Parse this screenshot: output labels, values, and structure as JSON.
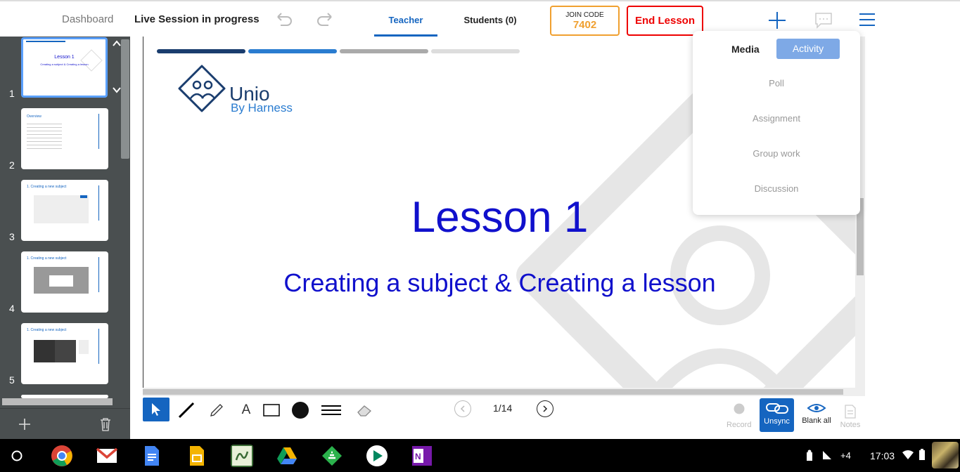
{
  "header": {
    "dashboard_label": "Dashboard",
    "session_label": "Live Session in progress",
    "tabs": [
      {
        "label": "Teacher",
        "active": true
      },
      {
        "label": "Students (0)",
        "active": false
      }
    ],
    "join_code": {
      "label": "JOIN CODE",
      "value": "7402"
    },
    "end_lesson_label": "End Lesson",
    "accent_color": "#1565c0",
    "join_code_color": "#f0a030",
    "end_lesson_color": "#e00000"
  },
  "sidebar": {
    "slides": [
      {
        "number": "1",
        "active": true,
        "title": "Lesson 1",
        "subtitle": "Creating a subject & Creating a lesson"
      },
      {
        "number": "2",
        "active": false,
        "title": "Overview"
      },
      {
        "number": "3",
        "active": false,
        "title": "1. Creating a new subject"
      },
      {
        "number": "4",
        "active": false,
        "title": "1. Creating a new subject"
      },
      {
        "number": "5",
        "active": false,
        "title": "1. Creating a new subject"
      }
    ]
  },
  "slide": {
    "logo_name": "Unio",
    "logo_sub": "By Harness",
    "title": "Lesson 1",
    "subtitle": "Creating a subject & Creating a lesson",
    "title_color": "#1010cc"
  },
  "dropdown": {
    "tabs": [
      {
        "label": "Media",
        "active": false
      },
      {
        "label": "Activity",
        "active": true
      }
    ],
    "items": [
      "Poll",
      "Assignment",
      "Group work",
      "Discussion"
    ]
  },
  "toolbar": {
    "tools": [
      "select-tool",
      "line-tool",
      "pen-tool",
      "text-tool",
      "rectangle-tool",
      "color-tool",
      "line-width-tool",
      "eraser-tool"
    ],
    "text_tool_label": "A",
    "page": "1/14",
    "record_label": "Record",
    "unsync_label": "Unsync",
    "blank_all_label": "Blank all",
    "notes_label": "Notes"
  },
  "taskbar": {
    "apps": [
      "chrome",
      "gmail",
      "docs",
      "slides",
      "app-green",
      "drive",
      "feedly",
      "play-store",
      "onenote"
    ],
    "notification_count": "+4",
    "time": "17:03"
  }
}
